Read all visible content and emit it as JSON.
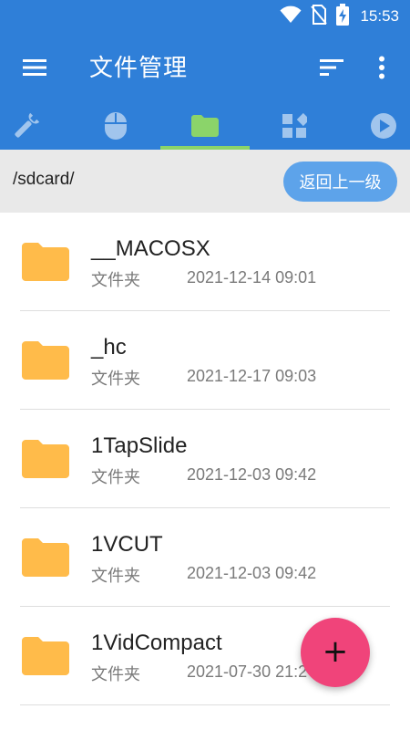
{
  "status_bar": {
    "time": "15:53",
    "icons": [
      "wifi-icon",
      "no-sim-icon",
      "battery-charging-icon"
    ]
  },
  "app_bar": {
    "title": "文件管理",
    "icons": [
      "menu-icon",
      "sort-icon",
      "more-vert-icon"
    ]
  },
  "tabs": [
    {
      "icon": "wrench-icon",
      "selected": false
    },
    {
      "icon": "mouse-icon",
      "selected": false
    },
    {
      "icon": "folder-icon",
      "selected": true
    },
    {
      "icon": "apps-icon",
      "selected": false
    },
    {
      "icon": "play-icon",
      "selected": false
    }
  ],
  "path_bar": {
    "path": "/sdcard/",
    "up_button_label": "返回上一级"
  },
  "files": [
    {
      "name": "__MACOSX",
      "type": "文件夹",
      "date": "2021-12-14 09:01"
    },
    {
      "name": "_hc",
      "type": "文件夹",
      "date": "2021-12-17 09:03"
    },
    {
      "name": "1TapSlide",
      "type": "文件夹",
      "date": "2021-12-03 09:42"
    },
    {
      "name": "1VCUT",
      "type": "文件夹",
      "date": "2021-12-03 09:42"
    },
    {
      "name": "1VidCompact",
      "type": "文件夹",
      "date": "2021-07-30 21:2"
    }
  ],
  "fab": {
    "label": "+",
    "icon": "add-icon"
  },
  "colors": {
    "primary": "#2f7fd8",
    "tab_indicator": "#8bd46a",
    "folder": "#ffbb4a",
    "fab": "#f0447a",
    "path_bar_bg": "#e9e9e9",
    "up_button": "#5da3ea"
  }
}
